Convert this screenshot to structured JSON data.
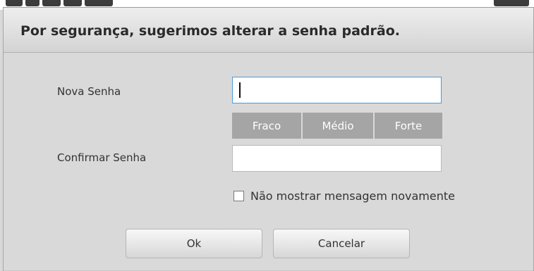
{
  "dialog": {
    "title": "Por segurança, sugerimos alterar a senha padrão."
  },
  "form": {
    "new_password": {
      "label": "Nova Senha",
      "value": ""
    },
    "strength": {
      "levels": [
        "Fraco",
        "Médio",
        "Forte"
      ]
    },
    "confirm_password": {
      "label": "Confirmar Senha",
      "value": ""
    },
    "dont_show_again": {
      "label": "Não mostrar mensagem novamente",
      "checked": false
    }
  },
  "buttons": {
    "ok_label": "Ok",
    "cancel_label": "Cancelar"
  },
  "colors": {
    "focus_border": "#4d9ad6",
    "strength_bar": "#a5a5a5",
    "dialog_background": "#d9d9d9"
  }
}
